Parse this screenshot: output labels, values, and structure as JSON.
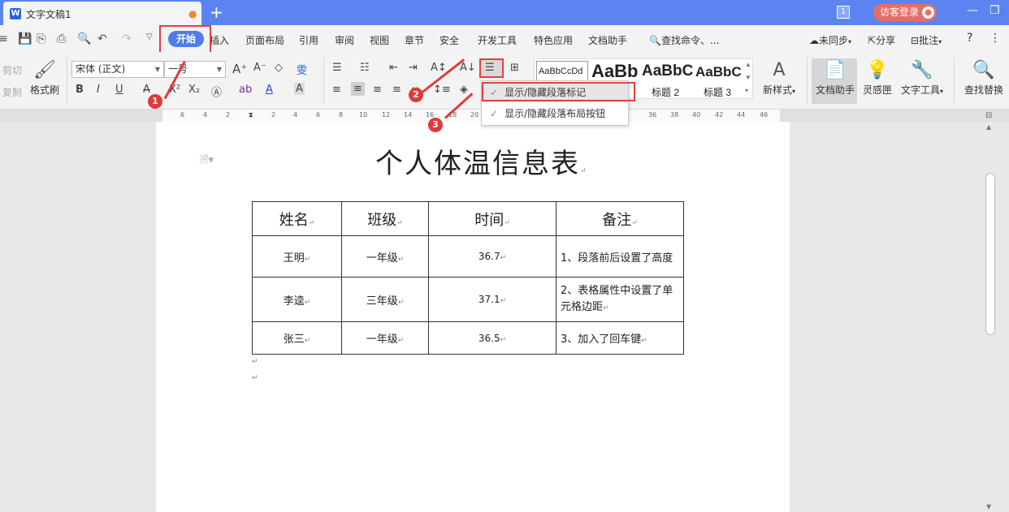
{
  "tabbar": {
    "doc_title": "文字文稿1",
    "login_label": "访客登录",
    "page_badge": "1"
  },
  "menubar": {
    "items": [
      "开始",
      "插入",
      "页面布局",
      "引用",
      "审阅",
      "视图",
      "章节",
      "安全",
      "开发工具",
      "特色应用",
      "文档助手"
    ],
    "search": "查找命令、...",
    "sync": "未同步",
    "share": "分享",
    "comment": "批注",
    "help": "?"
  },
  "ribbon": {
    "cut": "剪切",
    "copy": "复制",
    "format_painter": "格式刷",
    "font_name": "宋体 (正文)",
    "font_size": "一号",
    "style_normal": "AaBbCcDd",
    "style_h1": "AaBb",
    "style_h2": "AaBbC",
    "style_h3": "AaBbC",
    "style_h2_label": "标题 2",
    "style_h3_label": "标题 3",
    "new_style": "新样式",
    "doc_helper": "文档助手",
    "inspiration": "灵感匣",
    "text_tools": "文字工具",
    "find_replace": "查找替换"
  },
  "dropdown": {
    "items": [
      "显示/隐藏段落标记",
      "显示/隐藏段落布局按钮"
    ]
  },
  "ruler": {
    "ticks": [
      "6",
      "4",
      "2",
      "2",
      "4",
      "6",
      "8",
      "10",
      "12",
      "14",
      "16",
      "18",
      "20",
      "36",
      "38",
      "40",
      "42",
      "44",
      "46"
    ]
  },
  "document": {
    "title": "个人体温信息表",
    "headers": [
      "姓名",
      "班级",
      "时间",
      "备注"
    ],
    "rows": [
      [
        "王明",
        "一年级",
        "36.7",
        "1、段落前后设置了高度"
      ],
      [
        "李逵",
        "三年级",
        "37.1",
        "2、表格属性中设置了单元格边距"
      ],
      [
        "张三",
        "一年级",
        "36.5",
        "3、加入了回车键"
      ]
    ]
  },
  "annotations": [
    "1",
    "2",
    "3"
  ],
  "colors": {
    "tabbar": "#5b84f0",
    "accent": "#4d7de8",
    "highlight": "#e24040",
    "login": "#e86c66"
  }
}
